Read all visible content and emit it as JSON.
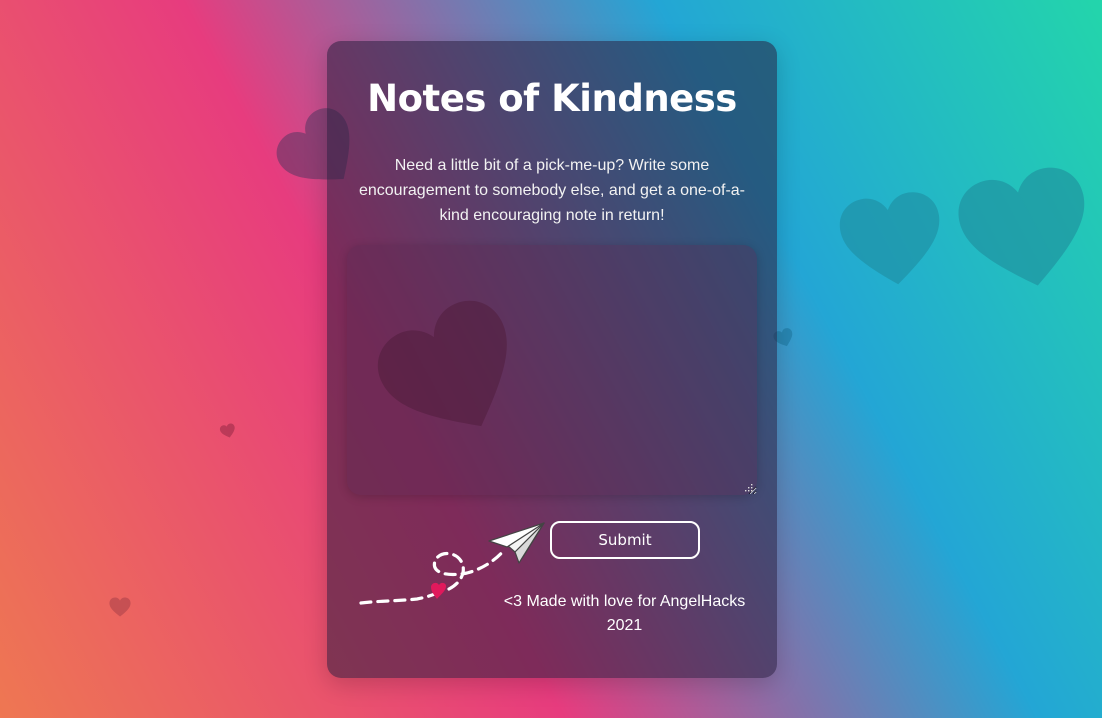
{
  "app": {
    "title": "Notes of Kindness",
    "intro": "Need a little bit of a pick-me-up? Write some encouragement to somebody else, and get a one-of-a-kind encouraging note in return!"
  },
  "note": {
    "value": "",
    "placeholder": ""
  },
  "actions": {
    "submit_label": "Submit"
  },
  "footer": {
    "text": "<3 Made with love for AngelHacks 2021"
  },
  "icons": {
    "background": "heart-icon",
    "doodle": "paper-plane-icon"
  },
  "colors": {
    "gradient_orange": "#ee7752",
    "gradient_pink": "#e73c7e",
    "gradient_blue": "#23a6d5",
    "gradient_teal": "#23d5ab",
    "accent_heart": "#e0195c",
    "text": "#ffffff"
  }
}
